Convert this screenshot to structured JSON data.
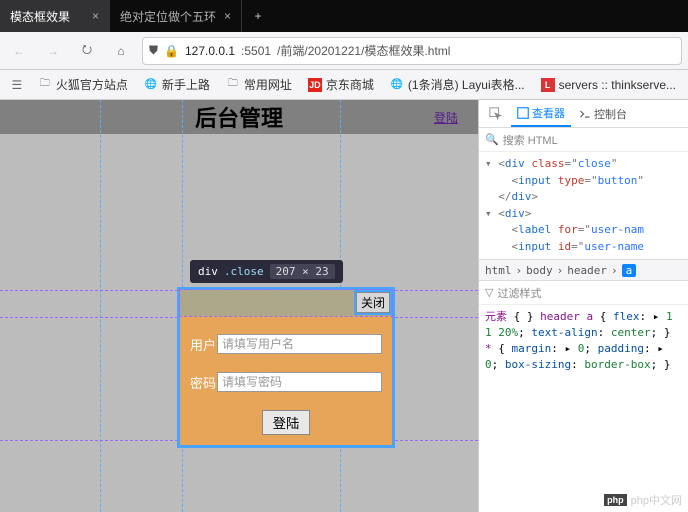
{
  "tabs": [
    {
      "title": "模态框效果",
      "active": true
    },
    {
      "title": "绝对定位做个五环",
      "active": false
    }
  ],
  "nav": {
    "shield": "⛊",
    "lock": "🔒",
    "url_host": "127.0.0.1",
    "url_port": ":5501",
    "url_path": "/前端/20201221/模态框效果.html"
  },
  "bookmarks": [
    {
      "icon": "folder",
      "label": "火狐官方站点"
    },
    {
      "icon": "globe",
      "label": "新手上路"
    },
    {
      "icon": "folder",
      "label": "常用网址"
    },
    {
      "icon": "jd",
      "label": "京东商城"
    },
    {
      "icon": "globe",
      "label": "(1条消息) Layui表格..."
    },
    {
      "icon": "L",
      "label": "servers :: thinkserve..."
    }
  ],
  "page": {
    "title": "后台管理",
    "login_link": "登陆"
  },
  "tooltip": {
    "el": "div",
    "cls": ".close",
    "dims": "207 × 23"
  },
  "modal": {
    "close": "关闭",
    "user_label": "用户",
    "user_placeholder": "请填写用户名",
    "pwd_label": "密码",
    "pwd_placeholder": "请填写密码",
    "submit": "登陆"
  },
  "devtools": {
    "tabs": {
      "inspector": "查看器",
      "console": "控制台"
    },
    "search": "搜索 HTML",
    "filter": "过滤样式",
    "crumbs": [
      "html",
      "body",
      "header",
      "a"
    ],
    "dom": {
      "l1a": "<",
      "l1b": "div",
      "l1c": " class",
      "l1d": "=\"",
      "l1e": "close",
      "l1f": "\"",
      "l2a": "<",
      "l2b": "input",
      "l2c": " type",
      "l2d": "=\"",
      "l2e": "button",
      "l2f": "\"",
      "l3a": "</",
      "l3b": "div",
      "l3c": ">",
      "l4a": "<",
      "l4b": "div",
      "l4c": ">",
      "l5a": "<",
      "l5b": "label",
      "l5c": " for",
      "l5d": "=\"",
      "l5e": "user-nam",
      "l6a": "<",
      "l6b": "input",
      "l6c": " id",
      "l6d": "=\"",
      "l6e": "user-name"
    },
    "styles": {
      "s1": "元素",
      "s2": "{",
      "s3": "}",
      "s4": "header a",
      "s5": "{",
      "s6p": "flex",
      "s6v": "1 1 20%",
      "s6e": ";",
      "s7p": "text-align",
      "s7v": "center",
      "s7e": ";",
      "s8": "}",
      "s9": "*",
      "s10": "{",
      "s11p": "margin",
      "s11v": "0",
      "s11e": ";",
      "s12p": "padding",
      "s12v": "0",
      "s12e": ";",
      "s13p": "box-sizing",
      "s13v": "border-box",
      "s13e": ";",
      "s14": "}"
    }
  },
  "watermark": "php中文网"
}
